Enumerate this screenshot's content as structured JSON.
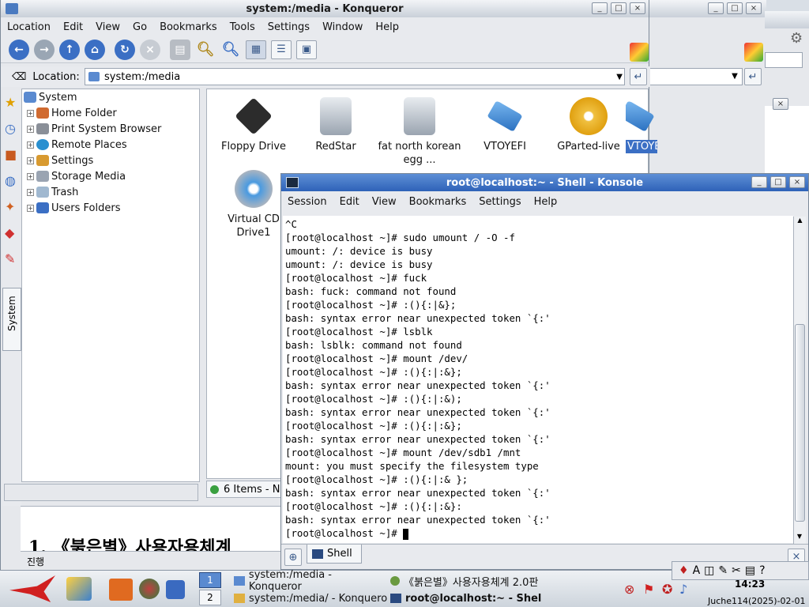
{
  "konqueror": {
    "title": "system:/media - Konqueror",
    "menu": [
      "Location",
      "Edit",
      "View",
      "Go",
      "Bookmarks",
      "Tools",
      "Settings",
      "Window",
      "Help"
    ],
    "location_label": "Location:",
    "location_value": "system:/media",
    "tree": [
      {
        "label": "System",
        "top": true
      },
      {
        "label": "Home Folder"
      },
      {
        "label": "Print System Browser"
      },
      {
        "label": "Remote Places"
      },
      {
        "label": "Settings"
      },
      {
        "label": "Storage Media"
      },
      {
        "label": "Trash"
      },
      {
        "label": "Users Folders"
      }
    ],
    "sidebar_tab": "System",
    "icons": [
      {
        "label": "Floppy Drive"
      },
      {
        "label": "RedStar"
      },
      {
        "label": "fat north korean egg ..."
      },
      {
        "label": "VTOYEFI"
      },
      {
        "label": "GParted-live"
      },
      {
        "label": "VTOYEFI"
      },
      {
        "label": "Virtual CD Drive1"
      }
    ],
    "status": "6 Items - N"
  },
  "konsole": {
    "title": "root@localhost:~ - Shell - Konsole",
    "menu": [
      "Session",
      "Edit",
      "View",
      "Bookmarks",
      "Settings",
      "Help"
    ],
    "tab": "Shell",
    "lines": [
      "^C",
      "[root@localhost ~]# sudo umount / -O -f",
      "umount: /: device is busy",
      "umount: /: device is busy",
      "[root@localhost ~]# fuck",
      "bash: fuck: command not found",
      "[root@localhost ~]# :(){:|&};",
      "bash: syntax error near unexpected token `{:'",
      "[root@localhost ~]# lsblk",
      "bash: lsblk: command not found",
      "[root@localhost ~]# mount /dev/",
      "[root@localhost ~]# :(){:|:&};",
      "bash: syntax error near unexpected token `{:'",
      "[root@localhost ~]# :(){:|:&);",
      "bash: syntax error near unexpected token `{:'",
      "[root@localhost ~]# :(){:|:&};",
      "bash: syntax error near unexpected token `{:'",
      "[root@localhost ~]# mount /dev/sdb1 /mnt",
      "mount: you must specify the filesystem type",
      "[root@localhost ~]# :(){:|:& };",
      "bash: syntax error near unexpected token `{:'",
      "[root@localhost ~]# :(){:|:&}:",
      "bash: syntax error near unexpected token `{:'",
      "[root@localhost ~]# "
    ]
  },
  "background_doc": {
    "heading": "1. 《붉은별》사용자용체계",
    "status": "진행"
  },
  "taskbar": {
    "desktops": [
      "1",
      "2"
    ],
    "tasks": [
      "system:/media - Konqueror",
      "《붉은별》사용자용체계 2.0판",
      "system:/media/ - Konqueror",
      "root@localhost:~ - Shell"
    ],
    "clock": "14:23",
    "date": "Juche114(2025)-02-01"
  }
}
